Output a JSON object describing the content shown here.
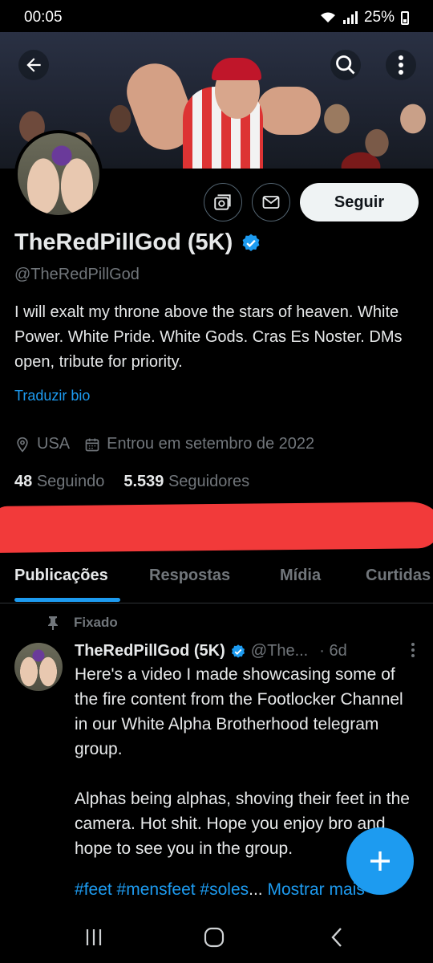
{
  "status_bar": {
    "time": "00:05",
    "battery": "25%"
  },
  "profile": {
    "display_name": "TheRedPillGod (5K)",
    "handle": "@TheRedPillGod",
    "bio": "I will exalt my throne above the stars of heaven. White Power. White Pride. White Gods. Cras Es Noster. DMs open, tribute for priority.",
    "translate_label": "Traduzir bio",
    "location": "USA",
    "joined": "Entrou em setembro de 2022",
    "following_count": "48",
    "following_label": "Seguindo",
    "followers_count": "5.539",
    "followers_label": "Seguidores",
    "follow_button": "Seguir"
  },
  "tabs": [
    {
      "label": "Publicações",
      "active": true
    },
    {
      "label": "Respostas",
      "active": false
    },
    {
      "label": "Mídia",
      "active": false
    },
    {
      "label": "Curtidas",
      "active": false
    }
  ],
  "pinned_post": {
    "pinned_label": "Fixado",
    "author_name": "TheRedPillGod (5K)",
    "author_handle": "@The...",
    "time": "· 6d",
    "text": "Here's a video I made showcasing some of the fire content from the Footlocker Channel in our White Alpha Brotherhood telegram group.\n\nAlphas being alphas, shoving their feet in the camera. Hot shit. Hope you enjoy bro and hope to see you in the group.",
    "hashtags": "#feet #mensfeet #soles",
    "ellipsis": "...",
    "show_more": "Mostrar mais"
  },
  "colors": {
    "accent": "#1d9bf0",
    "background": "#000000",
    "redaction": "#f23a3a"
  },
  "icons": [
    "back-arrow-icon",
    "search-icon",
    "more-vertical-icon",
    "subscribe-icon",
    "mail-icon",
    "verified-badge-icon",
    "location-pin-icon",
    "calendar-icon",
    "pin-icon",
    "compose-plus-icon",
    "recent-apps-icon",
    "home-icon",
    "back-icon"
  ]
}
